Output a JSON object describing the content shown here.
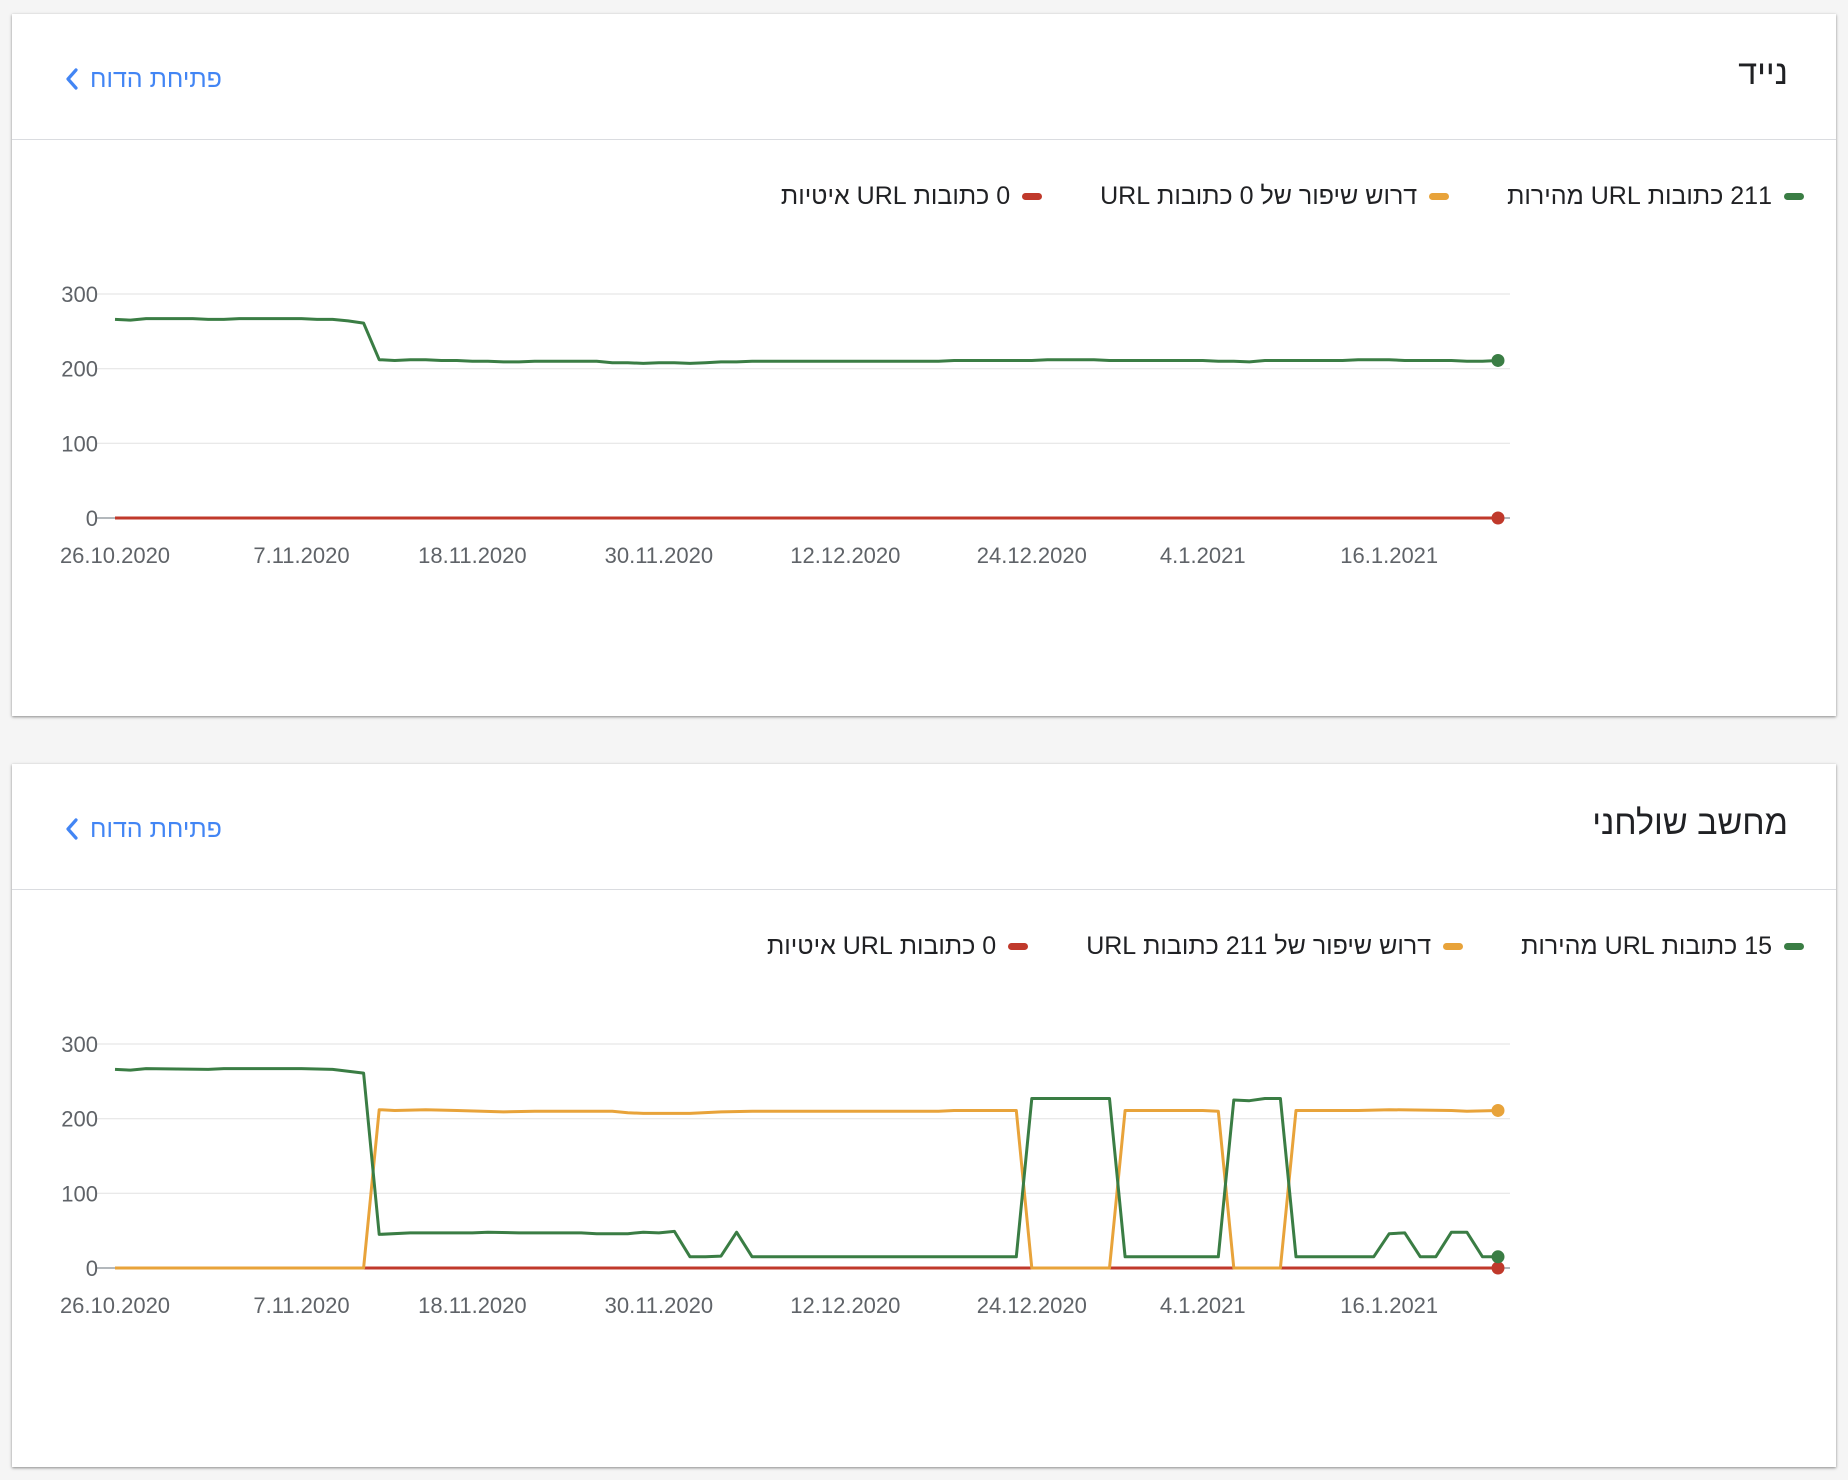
{
  "cards": [
    {
      "title": "נייד",
      "open_report_label": "פתיחת הדוח",
      "legend": [
        {
          "label": "0 כתובות URL איטיות",
          "color": "#c0392b"
        },
        {
          "label": "דרוש שיפור של 0 כתובות URL",
          "color": "#e8a33a"
        },
        {
          "label": "211 כתובות URL מהירות",
          "color": "#3a7d44"
        }
      ]
    },
    {
      "title": "מחשב שולחני",
      "open_report_label": "פתיחת הדוח",
      "legend": [
        {
          "label": "0 כתובות URL איטיות",
          "color": "#c0392b"
        },
        {
          "label": "דרוש שיפור של 211 כתובות URL",
          "color": "#e8a33a"
        },
        {
          "label": "15 כתובות URL מהירות",
          "color": "#3a7d44"
        }
      ]
    }
  ],
  "chart_data": [
    {
      "type": "line",
      "title": "נייד",
      "x_start": "26.10.2020",
      "x_end": "23.1.2021",
      "x_tick_labels": [
        "26.10.2020",
        "7.11.2020",
        "18.11.2020",
        "30.11.2020",
        "12.12.2020",
        "24.12.2020",
        "4.1.2021",
        "16.1.2021"
      ],
      "y_ticks": [
        0,
        100,
        200,
        300
      ],
      "ylim": [
        0,
        300
      ],
      "grid": true,
      "legend_position": "top",
      "series": [
        {
          "name": "0 כתובות URL איטיות",
          "color": "#c0392b",
          "end_marker": true,
          "points": [
            [
              "26.10.2020",
              0
            ],
            [
              "23.1.2021",
              0
            ]
          ]
        },
        {
          "name": "211 כתובות URL מהירות",
          "color": "#3a7d44",
          "end_marker": true,
          "points": [
            [
              "26.10.2020",
              266
            ],
            [
              "27.10.2020",
              265
            ],
            [
              "28.10.2020",
              267
            ],
            [
              "30.10.2020",
              267
            ],
            [
              "31.10.2020",
              267
            ],
            [
              "1.11.2020",
              266
            ],
            [
              "2.11.2020",
              266
            ],
            [
              "3.11.2020",
              267
            ],
            [
              "5.11.2020",
              267
            ],
            [
              "7.11.2020",
              267
            ],
            [
              "8.11.2020",
              266
            ],
            [
              "9.11.2020",
              266
            ],
            [
              "10.11.2020",
              264
            ],
            [
              "11.11.2020",
              261
            ],
            [
              "12.11.2020",
              212
            ],
            [
              "13.11.2020",
              211
            ],
            [
              "14.11.2020",
              212
            ],
            [
              "15.11.2020",
              212
            ],
            [
              "16.11.2020",
              211
            ],
            [
              "17.11.2020",
              211
            ],
            [
              "18.11.2020",
              210
            ],
            [
              "19.11.2020",
              210
            ],
            [
              "20.11.2020",
              209
            ],
            [
              "21.11.2020",
              209
            ],
            [
              "22.11.2020",
              210
            ],
            [
              "25.11.2020",
              210
            ],
            [
              "26.11.2020",
              210
            ],
            [
              "27.11.2020",
              208
            ],
            [
              "28.11.2020",
              208
            ],
            [
              "29.11.2020",
              207
            ],
            [
              "30.11.2020",
              208
            ],
            [
              "1.12.2020",
              208
            ],
            [
              "2.12.2020",
              207
            ],
            [
              "3.12.2020",
              208
            ],
            [
              "4.12.2020",
              209
            ],
            [
              "5.12.2020",
              209
            ],
            [
              "6.12.2020",
              210
            ],
            [
              "12.12.2020",
              210
            ],
            [
              "18.12.2020",
              210
            ],
            [
              "19.12.2020",
              211
            ],
            [
              "24.12.2020",
              211
            ],
            [
              "25.12.2020",
              212
            ],
            [
              "28.12.2020",
              212
            ],
            [
              "29.12.2020",
              211
            ],
            [
              "4.1.2021",
              211
            ],
            [
              "5.1.2021",
              210
            ],
            [
              "6.1.2021",
              210
            ],
            [
              "7.1.2021",
              209
            ],
            [
              "8.1.2021",
              211
            ],
            [
              "13.1.2021",
              211
            ],
            [
              "14.1.2021",
              212
            ],
            [
              "16.1.2021",
              212
            ],
            [
              "17.1.2021",
              211
            ],
            [
              "20.1.2021",
              211
            ],
            [
              "21.1.2021",
              210
            ],
            [
              "22.1.2021",
              210
            ],
            [
              "23.1.2021",
              211
            ]
          ]
        }
      ]
    },
    {
      "type": "line",
      "title": "מחשב שולחני",
      "x_start": "26.10.2020",
      "x_end": "23.1.2021",
      "x_tick_labels": [
        "26.10.2020",
        "7.11.2020",
        "18.11.2020",
        "30.11.2020",
        "12.12.2020",
        "24.12.2020",
        "4.1.2021",
        "16.1.2021"
      ],
      "y_ticks": [
        0,
        100,
        200,
        300
      ],
      "ylim": [
        0,
        300
      ],
      "grid": true,
      "legend_position": "top",
      "series": [
        {
          "name": "0 כתובות URL איטיות",
          "color": "#c0392b",
          "end_marker": true,
          "points": [
            [
              "26.10.2020",
              0
            ],
            [
              "23.1.2021",
              0
            ]
          ]
        },
        {
          "name": "דרוש שיפור של 211 כתובות URL",
          "color": "#e8a33a",
          "end_marker": true,
          "points": [
            [
              "26.10.2020",
              0
            ],
            [
              "11.11.2020",
              0
            ],
            [
              "12.11.2020",
              212
            ],
            [
              "13.11.2020",
              211
            ],
            [
              "15.11.2020",
              212
            ],
            [
              "17.11.2020",
              211
            ],
            [
              "20.11.2020",
              209
            ],
            [
              "22.11.2020",
              210
            ],
            [
              "27.11.2020",
              210
            ],
            [
              "28.11.2020",
              208
            ],
            [
              "29.11.2020",
              207
            ],
            [
              "2.12.2020",
              207
            ],
            [
              "4.12.2020",
              209
            ],
            [
              "6.12.2020",
              210
            ],
            [
              "18.12.2020",
              210
            ],
            [
              "19.12.2020",
              211
            ],
            [
              "23.12.2020",
              211
            ],
            [
              "24.12.2020",
              0
            ],
            [
              "29.12.2020",
              0
            ],
            [
              "30.12.2020",
              211
            ],
            [
              "4.1.2021",
              211
            ],
            [
              "5.1.2021",
              210
            ],
            [
              "6.1.2021",
              0
            ],
            [
              "9.1.2021",
              0
            ],
            [
              "10.1.2021",
              211
            ],
            [
              "14.1.2021",
              211
            ],
            [
              "16.1.2021",
              212
            ],
            [
              "20.1.2021",
              211
            ],
            [
              "21.1.2021",
              210
            ],
            [
              "23.1.2021",
              211
            ]
          ]
        },
        {
          "name": "15 כתובות URL מהירות",
          "color": "#3a7d44",
          "end_marker": true,
          "points": [
            [
              "26.10.2020",
              266
            ],
            [
              "27.10.2020",
              265
            ],
            [
              "28.10.2020",
              267
            ],
            [
              "1.11.2020",
              266
            ],
            [
              "2.11.2020",
              267
            ],
            [
              "7.11.2020",
              267
            ],
            [
              "9.11.2020",
              266
            ],
            [
              "11.11.2020",
              261
            ],
            [
              "12.11.2020",
              45
            ],
            [
              "14.11.2020",
              47
            ],
            [
              "18.11.2020",
              47
            ],
            [
              "19.11.2020",
              48
            ],
            [
              "21.11.2020",
              47
            ],
            [
              "25.11.2020",
              47
            ],
            [
              "26.11.2020",
              46
            ],
            [
              "28.11.2020",
              46
            ],
            [
              "29.11.2020",
              48
            ],
            [
              "30.11.2020",
              47
            ],
            [
              "1.12.2020",
              49
            ],
            [
              "2.12.2020",
              15
            ],
            [
              "3.12.2020",
              15
            ],
            [
              "4.12.2020",
              16
            ],
            [
              "5.12.2020",
              48
            ],
            [
              "6.12.2020",
              15
            ],
            [
              "23.12.2020",
              15
            ],
            [
              "24.12.2020",
              227
            ],
            [
              "29.12.2020",
              227
            ],
            [
              "30.12.2020",
              15
            ],
            [
              "5.1.2021",
              15
            ],
            [
              "6.1.2021",
              225
            ],
            [
              "7.1.2021",
              224
            ],
            [
              "8.1.2021",
              227
            ],
            [
              "9.1.2021",
              227
            ],
            [
              "10.1.2021",
              15
            ],
            [
              "15.1.2021",
              15
            ],
            [
              "16.1.2021",
              46
            ],
            [
              "17.1.2021",
              47
            ],
            [
              "18.1.2021",
              15
            ],
            [
              "19.1.2021",
              15
            ],
            [
              "20.1.2021",
              48
            ],
            [
              "21.1.2021",
              48
            ],
            [
              "22.1.2021",
              15
            ],
            [
              "23.1.2021",
              15
            ]
          ]
        }
      ]
    }
  ]
}
